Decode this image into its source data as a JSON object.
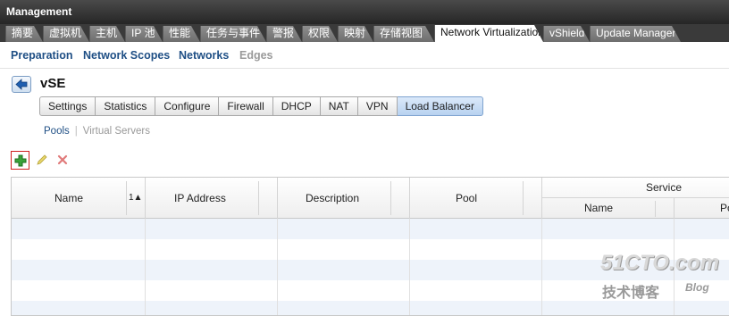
{
  "window": {
    "title": "Management"
  },
  "tabs": [
    {
      "label": "摘要",
      "active": false
    },
    {
      "label": "虚拟机",
      "active": false
    },
    {
      "label": "主机",
      "active": false
    },
    {
      "label": "IP 池",
      "active": false
    },
    {
      "label": "性能",
      "active": false
    },
    {
      "label": "任务与事件",
      "active": false
    },
    {
      "label": "警报",
      "active": false
    },
    {
      "label": "权限",
      "active": false
    },
    {
      "label": "映射",
      "active": false
    },
    {
      "label": "存储视图",
      "active": false
    },
    {
      "label": "Network Virtualization",
      "active": true
    },
    {
      "label": "vShield",
      "active": false
    },
    {
      "label": "Update Manager",
      "active": false
    }
  ],
  "subnav": {
    "items": [
      "Preparation",
      "Network Scopes",
      "Networks",
      "Edges"
    ]
  },
  "header": {
    "title": "vSE",
    "back_icon": "back-arrow-icon"
  },
  "segments": {
    "items": [
      "Settings",
      "Statistics",
      "Configure",
      "Firewall",
      "DHCP",
      "NAT",
      "VPN",
      "Load Balancer"
    ],
    "active": "Load Balancer"
  },
  "poolnav": {
    "pools": "Pools",
    "separator": "|",
    "virtual_servers": "Virtual Servers"
  },
  "toolbar": {
    "add_icon": "plus-icon",
    "edit_icon": "pencil-icon",
    "delete_icon": "x-icon"
  },
  "table": {
    "columns": {
      "name": "Name",
      "sort_indicator": "1▲",
      "ip_address": "IP Address",
      "description": "Description",
      "pool": "Pool",
      "service_group": "Service",
      "service_name": "Name",
      "service_po": "Po"
    },
    "rows": []
  },
  "watermark": {
    "site": "51CTO.com",
    "cn": "技术博客",
    "blog": "Blog"
  },
  "colors": {
    "accent": "#1f4f85",
    "active_segment": "#b8d2f0",
    "alt_row": "#eef3fa"
  }
}
